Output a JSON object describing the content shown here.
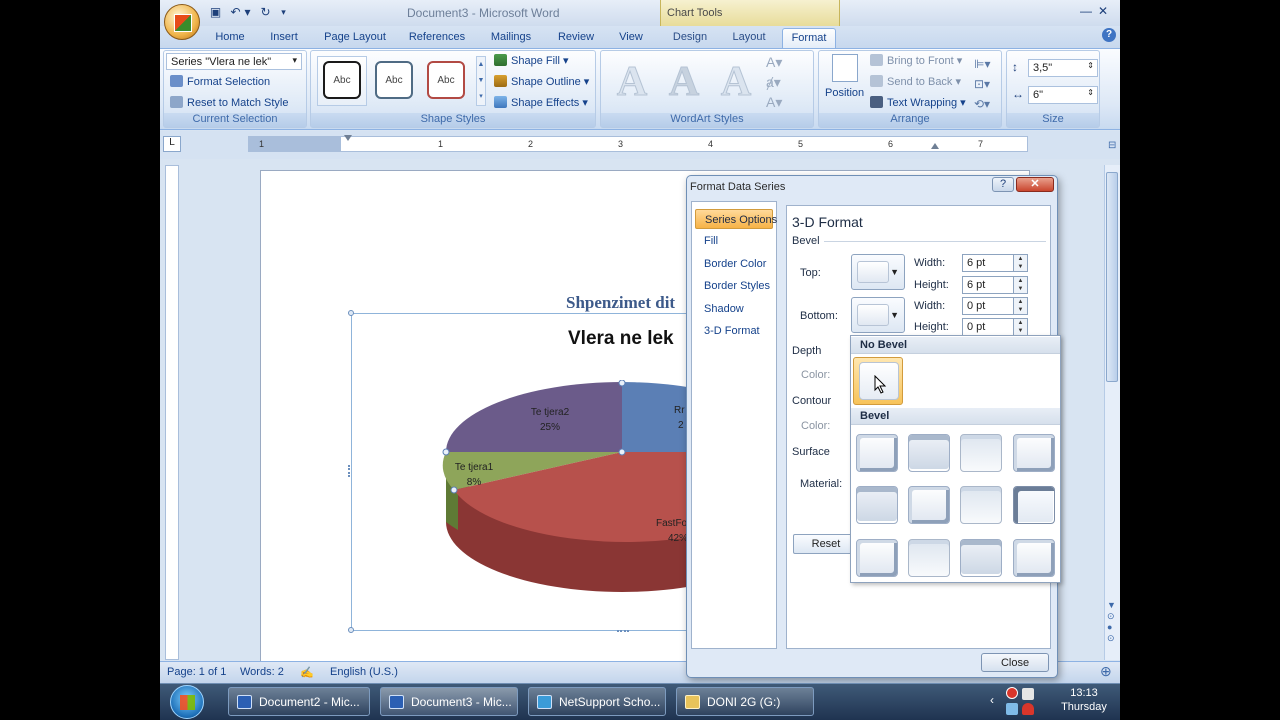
{
  "window": {
    "doc_title": "Document3 - Microsoft Word",
    "contextual_group": "Chart Tools"
  },
  "tabs": [
    "Home",
    "Insert",
    "Page Layout",
    "References",
    "Mailings",
    "Review",
    "View",
    "Design",
    "Layout",
    "Format"
  ],
  "ribbon": {
    "current_selection": {
      "series_value": "Series \"Vlera ne lek\"",
      "format_selection": "Format Selection",
      "reset_style": "Reset to Match Style",
      "label": "Current Selection"
    },
    "shape_styles": {
      "style_text": "Abc",
      "shape_fill": "Shape Fill",
      "shape_outline": "Shape Outline",
      "shape_effects": "Shape Effects",
      "label": "Shape Styles"
    },
    "wordart": {
      "letter": "A",
      "label": "WordArt Styles"
    },
    "arrange": {
      "position": "Position",
      "bring_to_front": "Bring to Front",
      "send_to_back": "Send to Back",
      "text_wrapping": "Text Wrapping",
      "label": "Arrange"
    },
    "size": {
      "height": "3,5\"",
      "width": "6\"",
      "label": "Size"
    }
  },
  "document": {
    "heading": "Shpenzimet dit",
    "chart_title": "Vlera ne lek",
    "pie_labels": [
      {
        "name": "Te tjera2",
        "pct": "25%"
      },
      {
        "name": "Te tjera1",
        "pct": "8%"
      },
      {
        "name": "Rr",
        "pct": "2"
      },
      {
        "name": "FastFo",
        "pct": "42%"
      }
    ]
  },
  "chart_data": {
    "type": "pie",
    "title": "Vlera ne lek",
    "categories": [
      "Te tjera2",
      "Te tjera1",
      "FastFood (partial)",
      "Rr (partial)"
    ],
    "values": [
      25,
      8,
      42,
      25
    ],
    "colors": [
      "#6b5b8a",
      "#8ea55a",
      "#b7514c",
      "#5b7fb5"
    ]
  },
  "ruler_numbers": [
    "1",
    "1",
    "2",
    "3",
    "4",
    "5",
    "6",
    "7"
  ],
  "dialog": {
    "title": "Format Data Series",
    "nav": [
      "Series Options",
      "Fill",
      "Border Color",
      "Border Styles",
      "Shadow",
      "3-D Format"
    ],
    "section_title": "3-D Format",
    "bevel_label": "Bevel",
    "top_label": "Top:",
    "bottom_label": "Bottom:",
    "width_label": "Width:",
    "height_label": "Height:",
    "top_width": "6 pt",
    "top_height": "6 pt",
    "bottom_width": "0 pt",
    "bottom_height": "0 pt",
    "depth_label": "Depth",
    "color_label": "Color:",
    "contour_label": "Contour",
    "surface_label": "Surface",
    "material_label": "Material:",
    "reset": "Reset",
    "close": "Close",
    "gallery": {
      "no_bevel": "No Bevel",
      "bevel": "Bevel"
    }
  },
  "status": {
    "page": "Page: 1 of 1",
    "words": "Words: 2",
    "language": "English (U.S.)"
  },
  "taskbar": {
    "items": [
      "Document2 - Mic...",
      "Document3 - Mic...",
      "NetSupport Scho...",
      "DONI 2G (G:)"
    ],
    "time": "13:13",
    "day": "Thursday"
  }
}
